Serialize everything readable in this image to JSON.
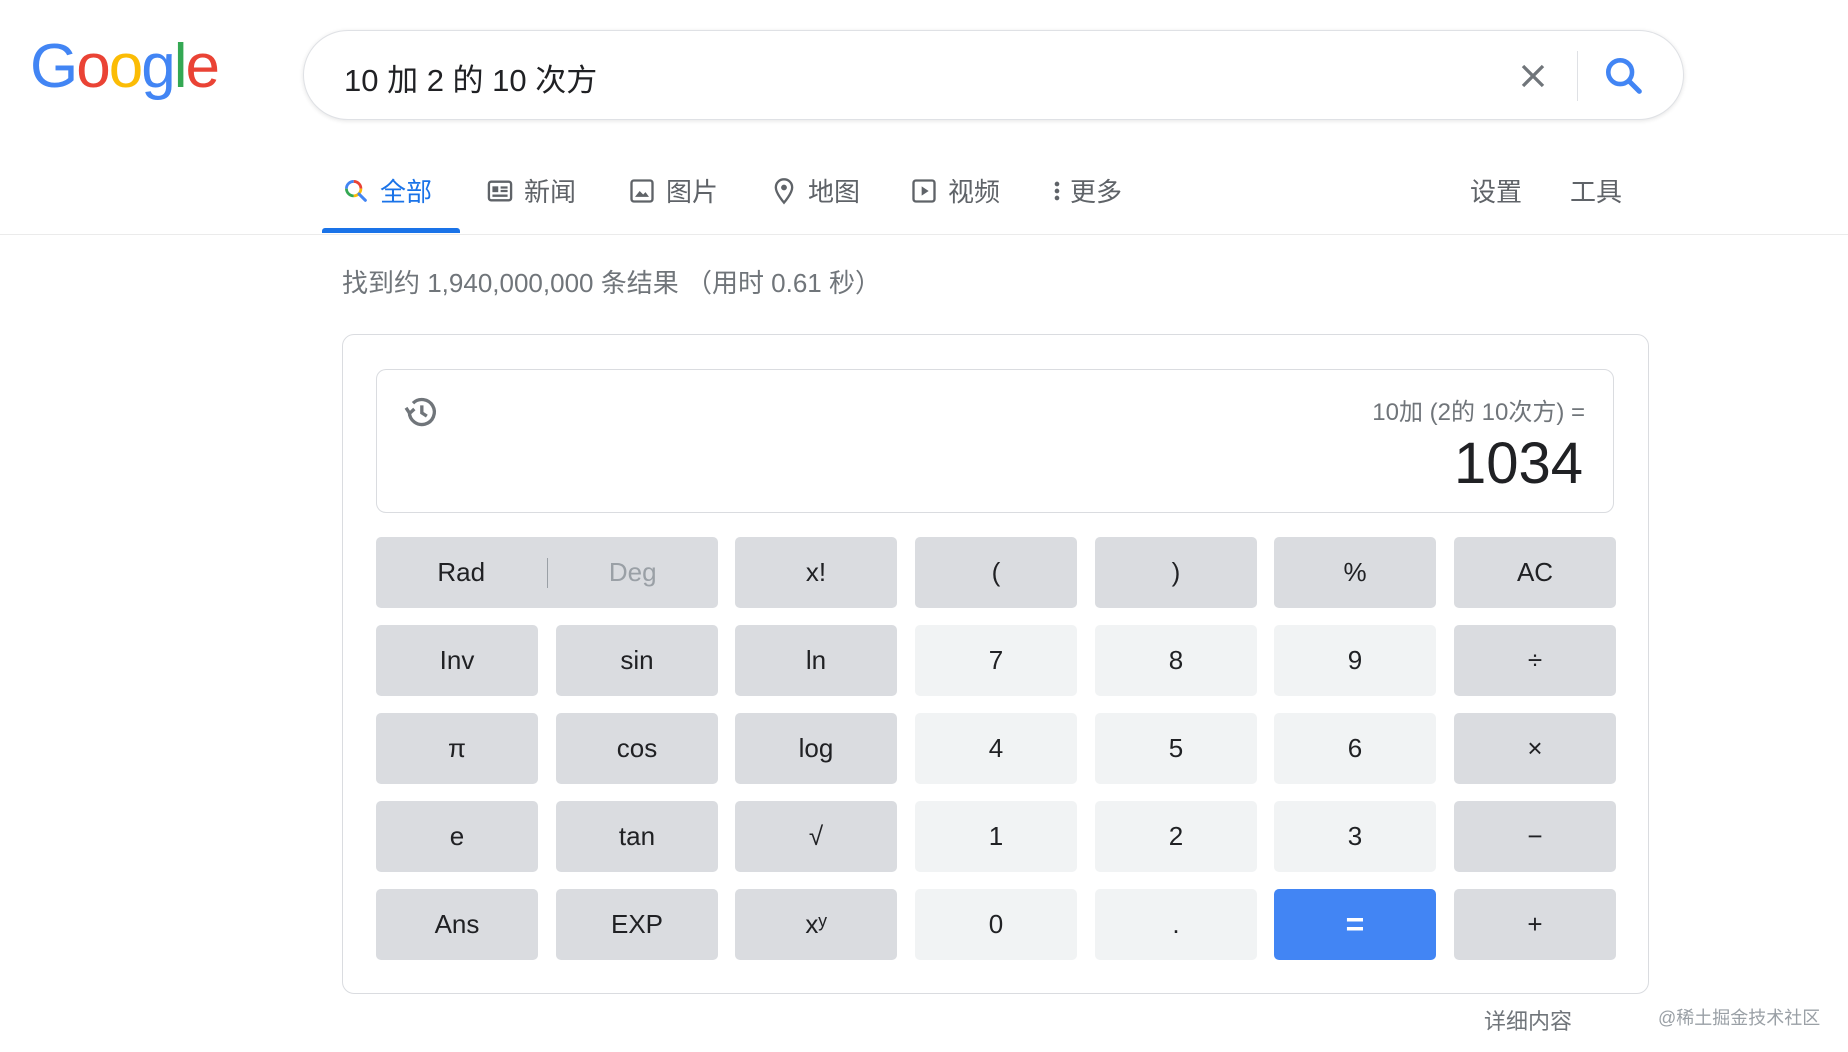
{
  "logo": {
    "letters": [
      "G",
      "o",
      "o",
      "g",
      "l",
      "e"
    ],
    "colors": [
      "#4285f4",
      "#ea4335",
      "#fbbc05",
      "#4285f4",
      "#34a853",
      "#ea4335"
    ]
  },
  "search": {
    "query": "10 加 2 的 10 次方",
    "clear_icon": "close-icon",
    "search_icon": "search-icon"
  },
  "nav": {
    "tabs": [
      {
        "label": "全部",
        "icon": "search-icon"
      },
      {
        "label": "新闻",
        "icon": "news-icon"
      },
      {
        "label": "图片",
        "icon": "image-icon"
      },
      {
        "label": "地图",
        "icon": "map-pin-icon"
      },
      {
        "label": "视频",
        "icon": "play-icon"
      },
      {
        "label": "更多",
        "icon": "more-vert-icon"
      }
    ],
    "settings": "设置",
    "tools": "工具"
  },
  "stats": "找到约 1,940,000,000 条结果 （用时 0.61 秒）",
  "calculator": {
    "expression": "10加 (2的 10次方) =",
    "result": "1034",
    "rad": "Rad",
    "deg": "Deg",
    "keys": [
      {
        "label": "x!",
        "kind": "fn"
      },
      {
        "label": "(",
        "kind": "fn"
      },
      {
        "label": ")",
        "kind": "fn"
      },
      {
        "label": "%",
        "kind": "fn"
      },
      {
        "label": "AC",
        "kind": "fn"
      },
      {
        "label": "Inv",
        "kind": "fn"
      },
      {
        "label": "sin",
        "kind": "fn"
      },
      {
        "label": "ln",
        "kind": "fn"
      },
      {
        "label": "7",
        "kind": "num"
      },
      {
        "label": "8",
        "kind": "num"
      },
      {
        "label": "9",
        "kind": "num"
      },
      {
        "label": "÷",
        "kind": "fn"
      },
      {
        "label": "π",
        "kind": "fn"
      },
      {
        "label": "cos",
        "kind": "fn"
      },
      {
        "label": "log",
        "kind": "fn"
      },
      {
        "label": "4",
        "kind": "num"
      },
      {
        "label": "5",
        "kind": "num"
      },
      {
        "label": "6",
        "kind": "num"
      },
      {
        "label": "×",
        "kind": "fn"
      },
      {
        "label": "e",
        "kind": "fn"
      },
      {
        "label": "tan",
        "kind": "fn"
      },
      {
        "label": "√",
        "kind": "fn"
      },
      {
        "label": "1",
        "kind": "num"
      },
      {
        "label": "2",
        "kind": "num"
      },
      {
        "label": "3",
        "kind": "num"
      },
      {
        "label": "−",
        "kind": "fn"
      },
      {
        "label": "Ans",
        "kind": "fn"
      },
      {
        "label": "EXP",
        "kind": "fn"
      },
      {
        "label": "xʸ",
        "kind": "fn"
      },
      {
        "label": "0",
        "kind": "num"
      },
      {
        "label": ".",
        "kind": "num"
      },
      {
        "label": "=",
        "kind": "eq"
      },
      {
        "label": "+",
        "kind": "fn"
      }
    ]
  },
  "more_details": "详细内容",
  "watermark": "@稀土掘金技术社区",
  "colors": {
    "accent": "#1a73e8",
    "equals": "#4285f4"
  }
}
